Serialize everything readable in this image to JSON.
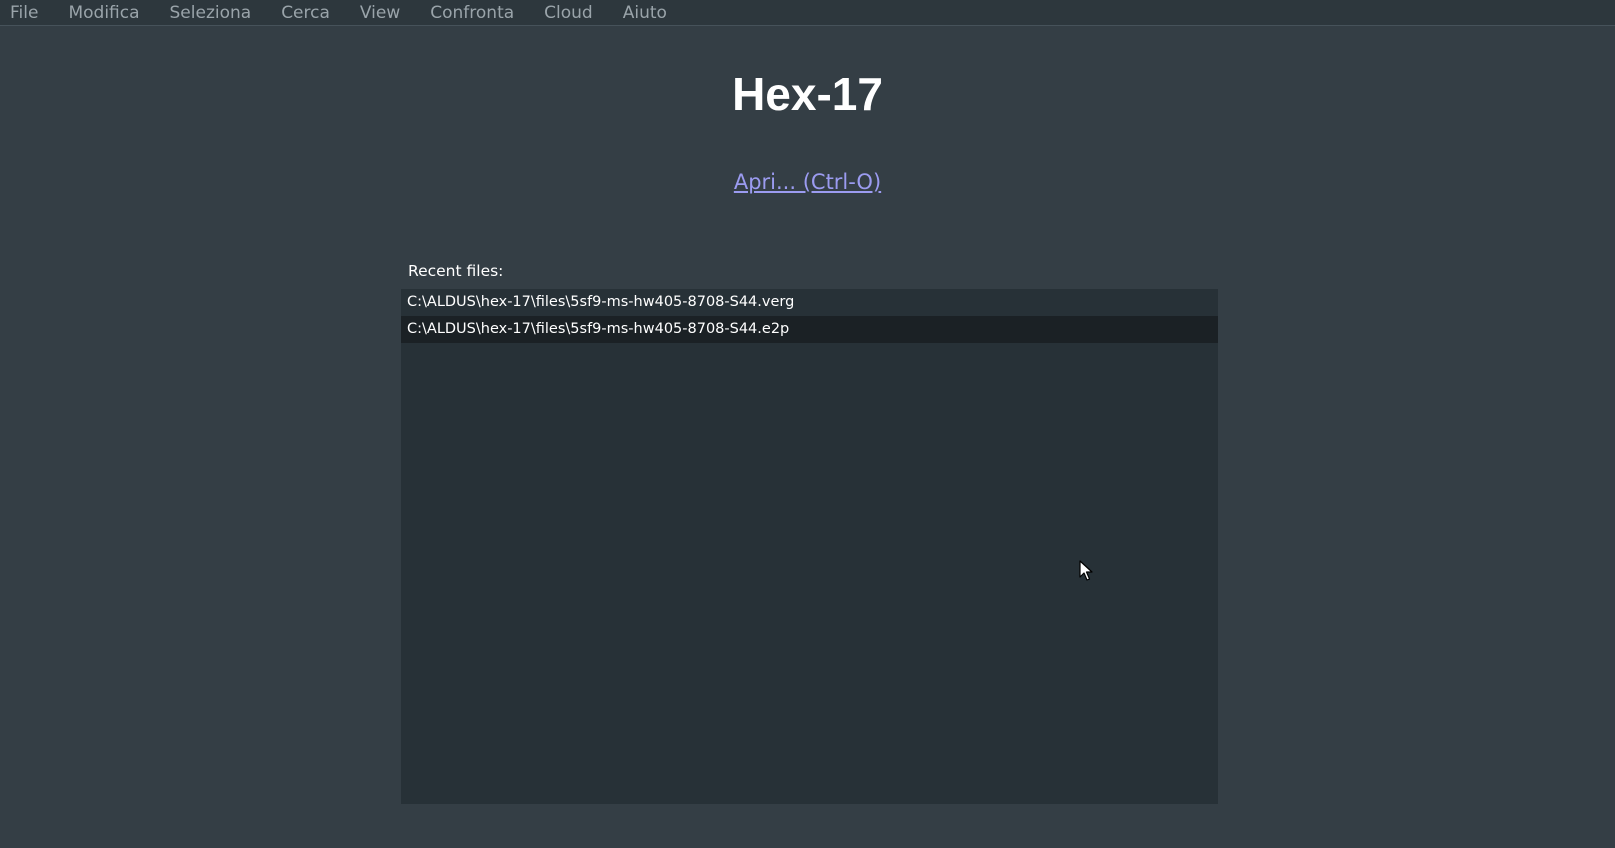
{
  "menubar": {
    "items": [
      "File",
      "Modifica",
      "Seleziona",
      "Cerca",
      "View",
      "Confronta",
      "Cloud",
      "Aiuto"
    ]
  },
  "welcome": {
    "title": "Hex-17",
    "open_link": "Apri... (Ctrl-O)",
    "recent_label": "Recent files:"
  },
  "recent_files": [
    "C:\\ALDUS\\hex-17\\files\\5sf9-ms-hw405-8708-S44.verg",
    "C:\\ALDUS\\hex-17\\files\\5sf9-ms-hw405-8708-S44.e2p"
  ],
  "colors": {
    "background": "#343e45",
    "menubar": "#2d373d",
    "list_background": "#273137",
    "row_highlight": "#1b2125",
    "link": "#9b9bf0"
  },
  "icons": {
    "cursor": "mouse-pointer-icon"
  }
}
